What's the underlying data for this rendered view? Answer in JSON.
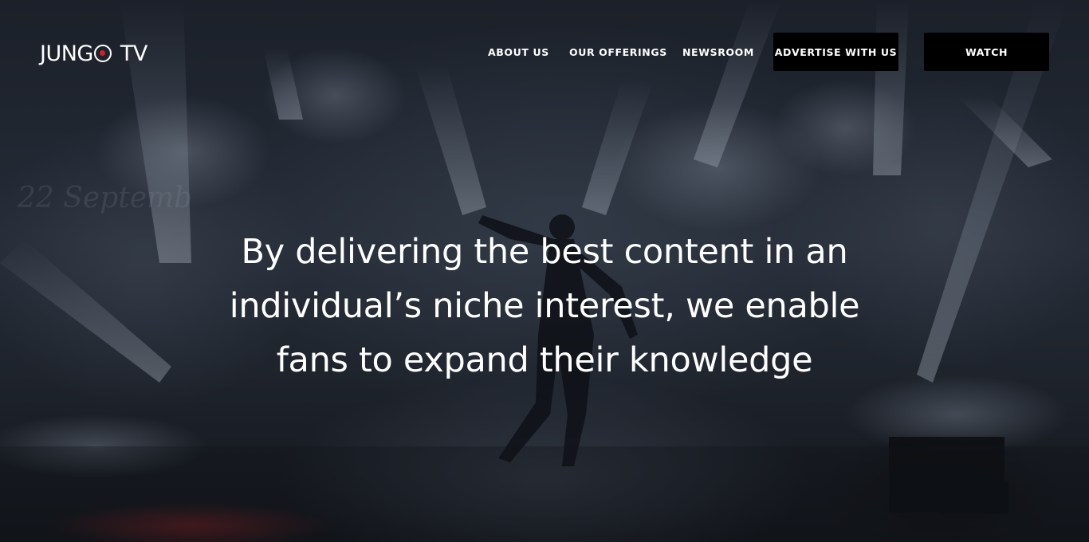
{
  "brand": {
    "logo_parts": [
      "JUNG",
      "TV"
    ],
    "accent_color": "#d31f2c"
  },
  "nav": {
    "items": [
      {
        "label": "ABOUT US"
      },
      {
        "label": "OUR OFFERINGS"
      },
      {
        "label": "NEWSROOM"
      }
    ],
    "advertise_label": "ADVERTISE WITH US",
    "watch_label": "WATCH"
  },
  "background": {
    "watermark_text": "22 Septemb"
  },
  "hero": {
    "lines": [
      "By delivering the best content in an",
      "individual’s niche interest, we enable",
      "fans to expand their knowledge"
    ]
  },
  "colors": {
    "text": "#ffffff",
    "button_bg": "#000000"
  }
}
